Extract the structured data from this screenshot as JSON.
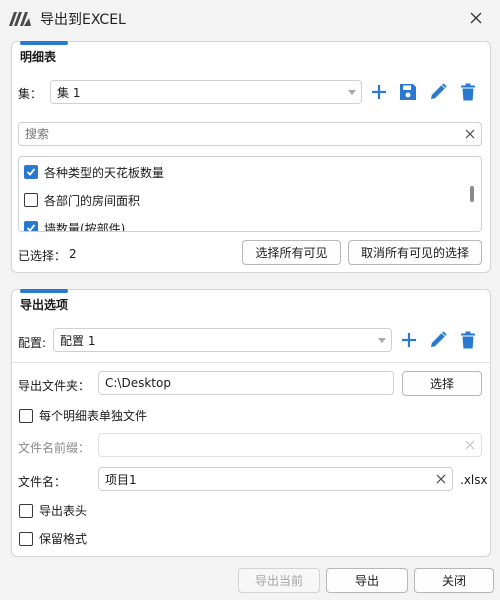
{
  "window": {
    "title": "导出到EXCEL",
    "logo_icon": "brand-logo-icon",
    "close_icon": "close-icon"
  },
  "colors": {
    "accent": "#2a79d0",
    "background": "#f3f3f3"
  },
  "detail_section": {
    "title": "明细表",
    "set_label": "集：",
    "set_value": "集 1",
    "actions": [
      "plus-icon",
      "save-icon",
      "pencil-icon",
      "trash-icon"
    ],
    "search_placeholder": "搜索",
    "items": [
      {
        "label": "各种类型的天花板数量",
        "checked": true
      },
      {
        "label": "各部门的房间面积",
        "checked": false
      },
      {
        "label": "墙数量(按部件)",
        "checked": true
      }
    ],
    "selected_label": "已选择：",
    "selected_count": "2",
    "select_all_button": "选择所有可见",
    "deselect_all_button": "取消所有可见的选择"
  },
  "export_section": {
    "title": "导出选项",
    "config_label": "配置:",
    "config_value": "配置 1",
    "actions": [
      "plus-icon",
      "pencil-icon",
      "trash-icon"
    ],
    "folder_label": "导出文件夹：",
    "folder_value": "C:\\Desktop",
    "browse_button": "选择",
    "separate_files_label": "每个明细表单独文件",
    "separate_files_checked": false,
    "prefix_label": "文件名前缀：",
    "prefix_value": "",
    "filename_label": "文件名：",
    "filename_value": "项目1",
    "extension": ".xlsx",
    "export_headers_label": "导出表头",
    "export_headers_checked": false,
    "keep_format_label": "保留格式",
    "keep_format_checked": false
  },
  "footer": {
    "export_current_button": "导出当前",
    "export_button": "导出",
    "close_button": "关闭"
  }
}
